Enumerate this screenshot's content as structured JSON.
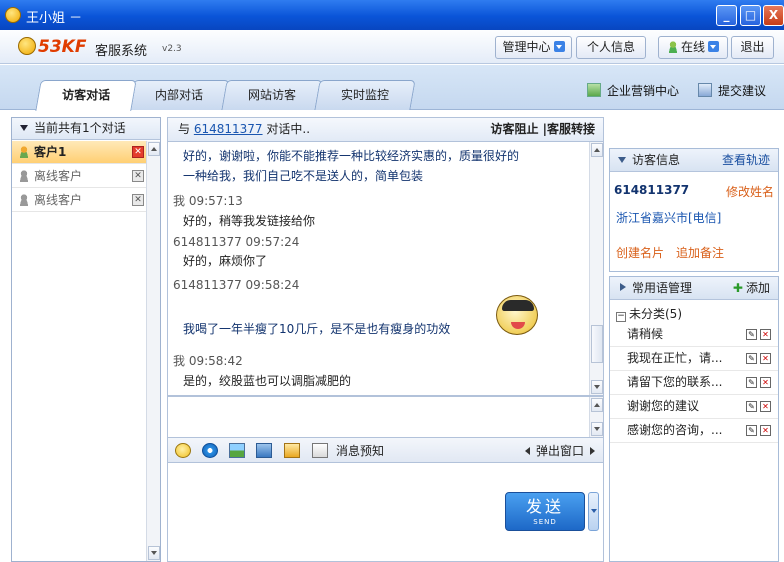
{
  "window": {
    "title": "王小姐 －",
    "controls": {
      "minimize": "_",
      "maximize": "□",
      "close": "X"
    }
  },
  "header": {
    "brand_logo": "53KF",
    "brand_name": "客服系统",
    "version": "v2.3",
    "buttons": {
      "manage": "管理中心",
      "profile": "个人信息",
      "status": "在线",
      "logout": "退出"
    }
  },
  "tabs": [
    {
      "label": "访客对话",
      "active": true
    },
    {
      "label": "内部对话"
    },
    {
      "label": "网站访客"
    },
    {
      "label": "实时监控"
    }
  ],
  "top_links": {
    "marketing": "企业营销中心",
    "suggest": "提交建议"
  },
  "left_panel": {
    "title": "当前共有1个对话",
    "customers": [
      {
        "name": "客户1",
        "active": true
      },
      {
        "name": "离线客户"
      },
      {
        "name": "离线客户"
      }
    ]
  },
  "chat": {
    "header_prefix": "与",
    "visitor_id": "614811377",
    "header_suffix": "对话中..",
    "actions": "访客阻止 |客服转接",
    "messages": [
      {
        "line1": "好的，谢谢啦，你能不能推荐一种比较经济实惠的，质量很好的",
        "line2": "一种给我，我们自己吃不是送人的，简单包装"
      },
      {
        "meta": "我 09:57:13",
        "text": "好的，稍等我发链接给你"
      },
      {
        "meta": "614811377 09:57:24",
        "text": "好的，麻烦你了"
      },
      {
        "meta": "614811377 09:58:24",
        "text": "我喝了一年半瘦了10几斤，是不是也有瘦身的功效"
      },
      {
        "meta": "我 09:58:42",
        "text": "是的，绞股蓝也可以调脂减肥的"
      }
    ]
  },
  "toolbar": {
    "quick_msg": "消息预知",
    "popup": "弹出窗口"
  },
  "send": {
    "label": "发送",
    "sub": "SEND"
  },
  "visitor_info": {
    "title": "访客信息",
    "track": "查看轨迹",
    "id": "614811377",
    "rename": "修改姓名",
    "location": "浙江省嘉兴市[电信]",
    "create_card": "创建名片",
    "add_note": "追加备注"
  },
  "phrases": {
    "title": "常用语管理",
    "add": "添加",
    "group": "未分类(5)",
    "group_toggle": "−",
    "items": [
      "请稍候",
      "我现在正忙，请...",
      "请留下您的联系...",
      "谢谢您的建议",
      "感谢您的咨询，..."
    ]
  },
  "colors": {
    "titlebar": "#0a54d8",
    "active_row": "#ffcf73",
    "link": "#1a56b0",
    "orange": "#d9601a"
  }
}
